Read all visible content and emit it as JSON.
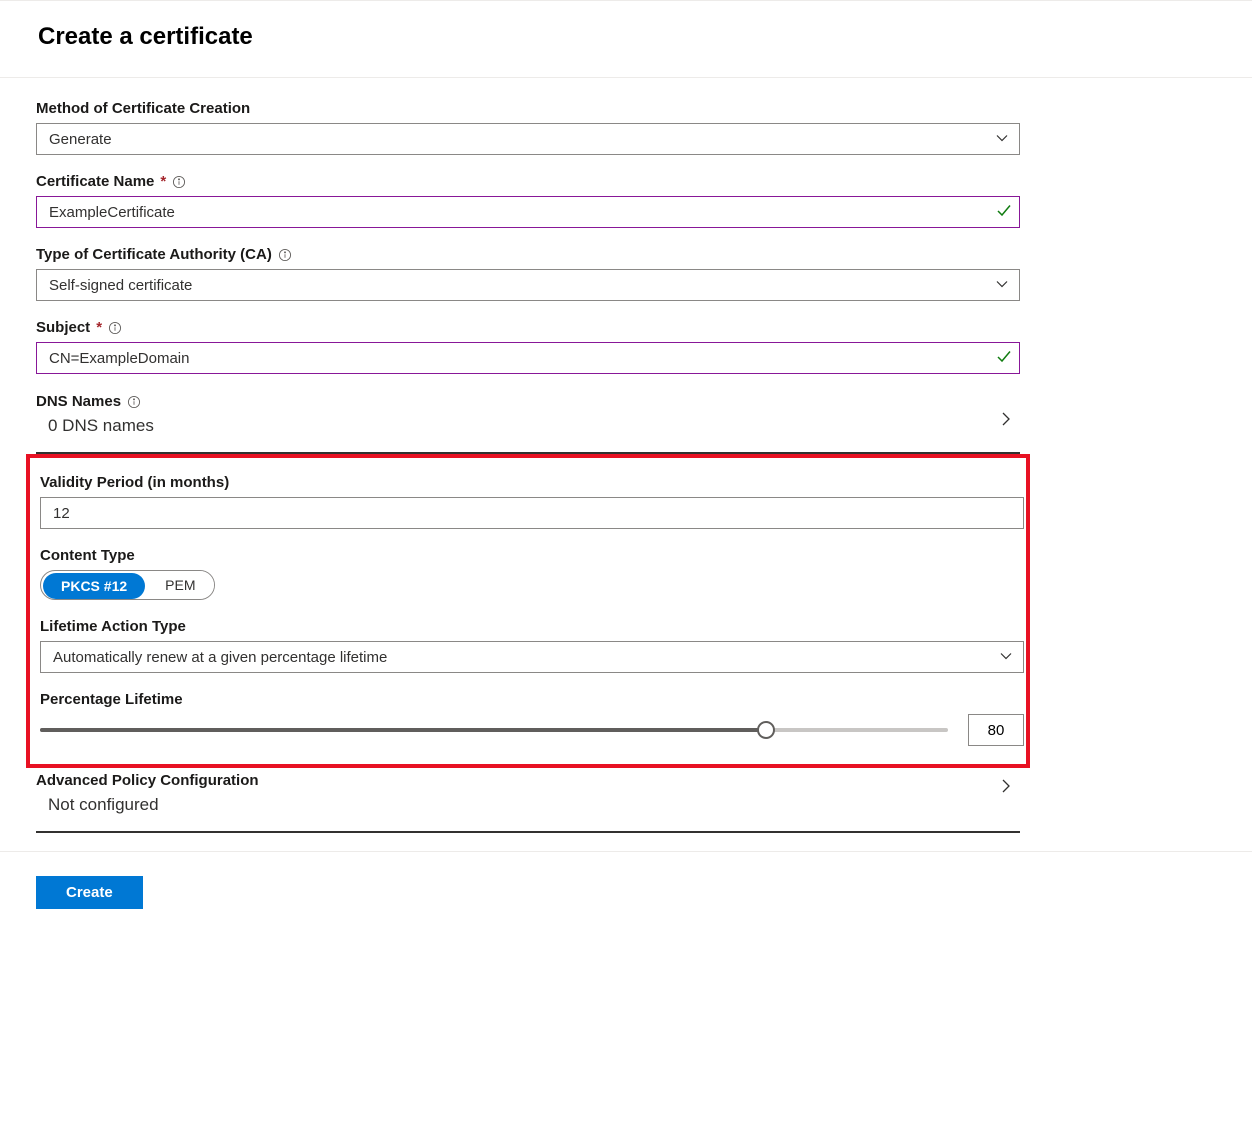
{
  "page": {
    "title": "Create a certificate"
  },
  "fields": {
    "method": {
      "label": "Method of Certificate Creation",
      "value": "Generate"
    },
    "name": {
      "label": "Certificate Name",
      "value": "ExampleCertificate",
      "required_marker": "*"
    },
    "ca": {
      "label": "Type of Certificate Authority (CA)",
      "value": "Self-signed certificate"
    },
    "subject": {
      "label": "Subject",
      "value": "CN=ExampleDomain",
      "required_marker": "*"
    },
    "dns": {
      "label": "DNS Names",
      "value": "0 DNS names"
    },
    "validity": {
      "label": "Validity Period (in months)",
      "value": "12"
    },
    "content_type": {
      "label": "Content Type",
      "option_a": "PKCS #12",
      "option_b": "PEM"
    },
    "lifetime_action": {
      "label": "Lifetime Action Type",
      "value": "Automatically renew at a given percentage lifetime"
    },
    "percentage": {
      "label": "Percentage Lifetime",
      "value": "80"
    },
    "advanced": {
      "label": "Advanced Policy Configuration",
      "value": "Not configured"
    }
  },
  "buttons": {
    "create": "Create"
  }
}
